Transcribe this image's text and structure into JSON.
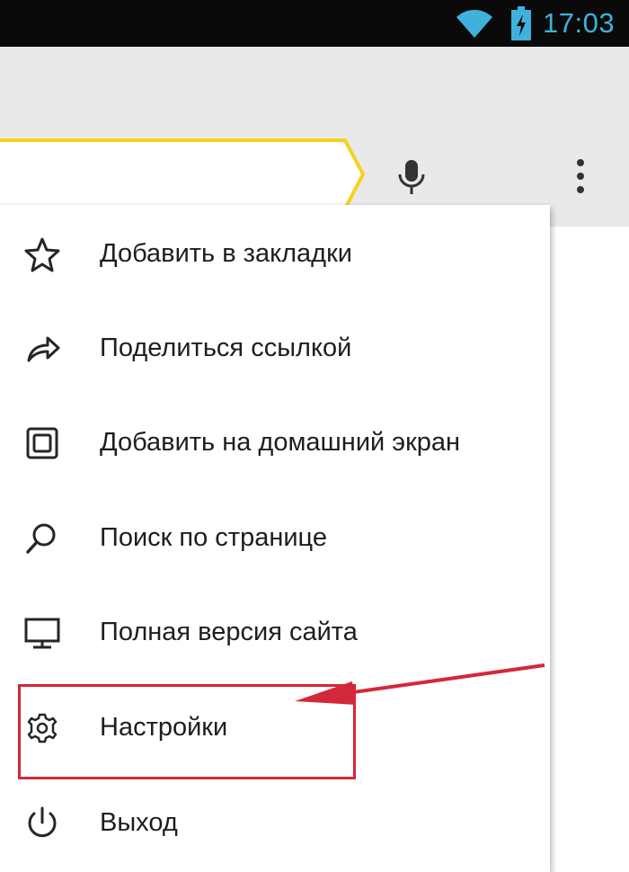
{
  "status_bar": {
    "time": "17:03",
    "icons": [
      "wifi-icon",
      "battery-charging-icon"
    ]
  },
  "toolbar": {
    "icons": [
      "microphone-icon",
      "more-vertical-icon"
    ],
    "accent_color": "#f4d21e"
  },
  "menu": {
    "items": [
      {
        "label": "Добавить в закладки",
        "icon": "star-icon"
      },
      {
        "label": "Поделиться ссылкой",
        "icon": "share-icon"
      },
      {
        "label": "Добавить на домашний экран",
        "icon": "home-screen-icon"
      },
      {
        "label": "Поиск по странице",
        "icon": "search-icon"
      },
      {
        "label": "Полная версия сайта",
        "icon": "desktop-icon"
      },
      {
        "label": "Настройки",
        "icon": "gear-icon"
      },
      {
        "label": "Выход",
        "icon": "power-icon"
      }
    ]
  },
  "annotation": {
    "highlight_color": "#d3283a",
    "highlighted_item": "Настройки"
  }
}
